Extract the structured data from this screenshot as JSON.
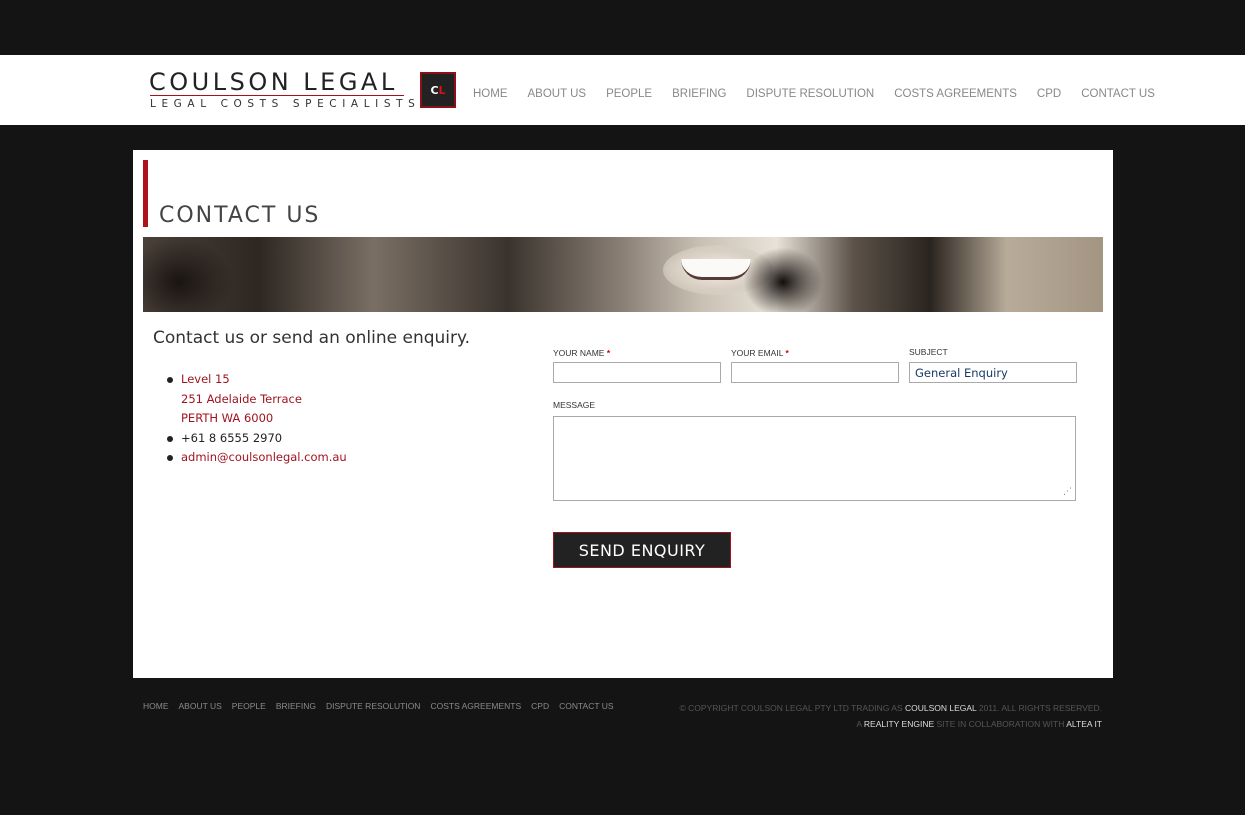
{
  "header": {
    "logo_name": "COULSON LEGAL",
    "logo_tagline": "LEGAL COSTS SPECIALISTS",
    "logo_mark_c": "C",
    "logo_mark_l": "L"
  },
  "nav": {
    "items": [
      "HOME",
      "ABOUT US",
      "PEOPLE",
      "BRIEFING",
      "DISPUTE RESOLUTION",
      "COSTS AGREEMENTS",
      "CPD",
      "CONTACT US"
    ]
  },
  "page": {
    "title": "CONTACT US",
    "intro": "Contact us or send an online enquiry."
  },
  "contact": {
    "address_line1": "Level 15",
    "address_line2": "251 Adelaide Terrace",
    "address_line3": "PERTH WA 6000",
    "phone": "+61 8 6555 2970",
    "email": "admin@coulsonlegal.com.au"
  },
  "form": {
    "name_label": "YOUR NAME",
    "email_label": "YOUR EMAIL",
    "required_mark": "*",
    "subject_label": "SUBJECT",
    "subject_value": "General Enquiry",
    "message_label": "MESSAGE",
    "name_value": "",
    "email_value": "",
    "message_value": "",
    "submit_label": "SEND ENQUIRY"
  },
  "footer": {
    "nav": [
      "HOME",
      "ABOUT US",
      "PEOPLE",
      "BRIEFING",
      "DISPUTE RESOLUTION",
      "COSTS AGREEMENTS",
      "CPD",
      "CONTACT US"
    ],
    "copyright_prefix": "© COPYRIGHT COULSON LEGAL PTY LTD TRADING AS",
    "copyright_brand": "COULSON LEGAL",
    "copyright_suffix": "2011. ALL RIGHTS RESERVED.",
    "credit_a": "A",
    "credit_agency": "REALITY ENGINE",
    "credit_mid": "SITE IN COLLABORATION WITH",
    "credit_partner": "ALTEA IT"
  },
  "colors": {
    "accent": "#a0141e",
    "page_background": "#141414",
    "subject_text": "#1a3a66"
  }
}
